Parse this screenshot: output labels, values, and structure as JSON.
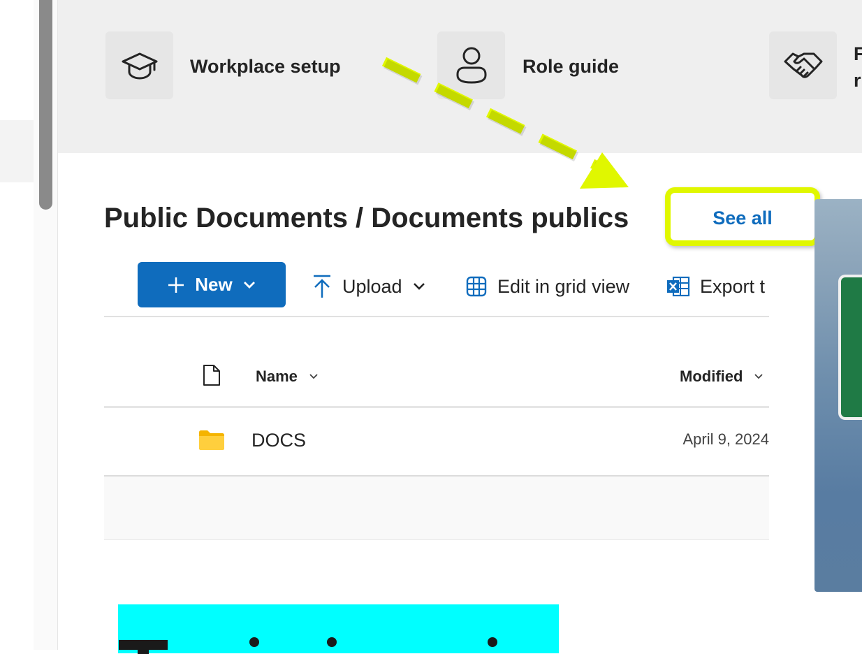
{
  "quick_links": [
    {
      "label": "Workplace setup",
      "icon": "graduation-cap-icon"
    },
    {
      "label": "Role guide",
      "icon": "person-icon"
    },
    {
      "label_line1": "F",
      "label_line2": "r",
      "icon": "handshake-icon"
    }
  ],
  "section": {
    "title": "Public Documents / Documents publics",
    "see_all": "See all"
  },
  "command_bar": {
    "new_label": "New",
    "upload_label": "Upload",
    "edit_grid_label": "Edit in grid view",
    "export_label": "Export t"
  },
  "table": {
    "columns": [
      {
        "label": "Name"
      },
      {
        "label": "Modified"
      }
    ],
    "rows": [
      {
        "name": "DOCS",
        "modified": "April 9, 2024",
        "type": "folder"
      }
    ]
  },
  "colors": {
    "accent": "#0f6cbd",
    "annotation": "#e0f700",
    "cyan_block": "#00ffff"
  }
}
